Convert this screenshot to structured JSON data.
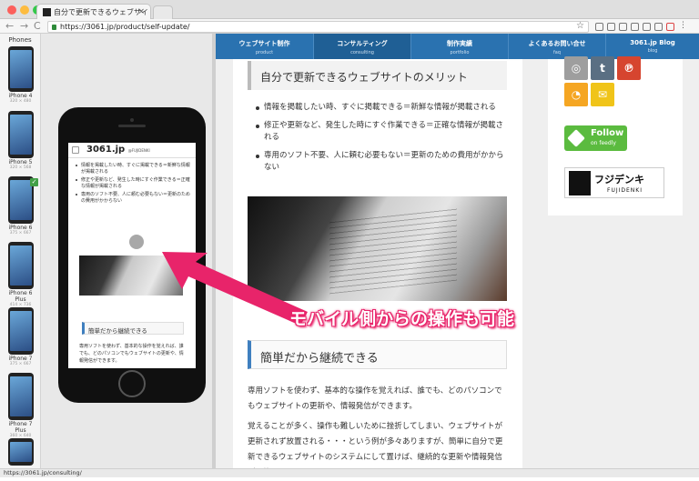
{
  "browser": {
    "tab_title": "自分で更新できるウェブサイト",
    "tab_close": "×",
    "url": "https://3061.jp/product/self-update/",
    "status_url": "https://3061.jp/consulting/",
    "traffic_colors": [
      "#fc605c",
      "#fdbc40",
      "#34c84a"
    ],
    "nav_back": "←",
    "nav_forward": "→",
    "nav_reload": "C"
  },
  "device_panel": {
    "header": "Phones",
    "devices": [
      {
        "name": "iPhone 4",
        "res": "320 × 480"
      },
      {
        "name": "iPhone 5",
        "res": "320 × 568"
      },
      {
        "name": "iPhone 6",
        "res": "375 × 667"
      },
      {
        "name": "iPhone 6 Plus",
        "res": "414 × 736"
      },
      {
        "name": "iPhone 7",
        "res": "375 × 667"
      },
      {
        "name": "iPhone 7 Plus",
        "res": "360 × 640"
      },
      {
        "name": "",
        "res": ""
      }
    ],
    "selected_index": 2
  },
  "phone": {
    "logo": "3061.jp",
    "logo_sub": "@FUJIDENKI",
    "bullets": [
      "情報を掲載したい時、すぐに掲載できる＝新鮮な情報が掲載される",
      "修正や更新など、発生した時にすぐ作業できる＝正確な情報が掲載される",
      "専用のソフト不要、人に頼む必要もない＝更新のための費用がかからない"
    ],
    "heading": "簡単だから継続できる",
    "paragraph": "専用ソフトを使わず、基本的な操作を覚えれば、誰でも、どのパソコンでもウェブサイトの更新や、情報発信ができます。"
  },
  "site_nav": [
    {
      "jp": "ウェブサイト制作",
      "en": "product"
    },
    {
      "jp": "コンサルティング",
      "en": "consulting"
    },
    {
      "jp": "制作実績",
      "en": "portfolio"
    },
    {
      "jp": "よくあるお問い合せ",
      "en": "faq"
    },
    {
      "jp": "3061.jp Blog",
      "en": "blog"
    }
  ],
  "site_nav_active_index": 1,
  "article": {
    "merit_heading": "自分で更新できるウェブサイトのメリット",
    "bullets": [
      "情報を掲載したい時、すぐに掲載できる＝新鮮な情報が掲載される",
      "修正や更新など、発生した時にすぐ作業できる＝正確な情報が掲載される",
      "専用のソフト不要、人に頼む必要もない＝更新のための費用がかからない"
    ],
    "caption": "モバイル側からの操作も可能",
    "heading2": "簡単だから継続できる",
    "para1": "専用ソフトを使わず、基本的な操作を覚えれば、誰でも、どのパソコンでもウェブサイトの更新や、情報発信ができます。",
    "para2": "覚えることが多く、操作も難しいために挫折してしまい、ウェブサイトが更新されず放置される・・・という例が多々ありますが、簡単に自分で更新できるウェブサイトのシステムにして置けば、継続的な更新や情報発信が可能になります。"
  },
  "sidebar": {
    "social": [
      {
        "icon": "instagram-icon",
        "glyph": "◎",
        "color": "#9e9e9e"
      },
      {
        "icon": "tumblr-icon",
        "glyph": "t",
        "color": "#5a6f83"
      },
      {
        "icon": "pinterest-icon",
        "glyph": "℗",
        "color": "#d6452f"
      },
      {
        "icon": "rss-icon",
        "glyph": "◔",
        "color": "#f5a623"
      },
      {
        "icon": "mail-icon",
        "glyph": "✉",
        "color": "#f0c419"
      }
    ],
    "feedly_title": "Follow",
    "feedly_sub": "on feedly",
    "logo_jp": "フジデンキ",
    "logo_en": "FUJIDENKI"
  }
}
